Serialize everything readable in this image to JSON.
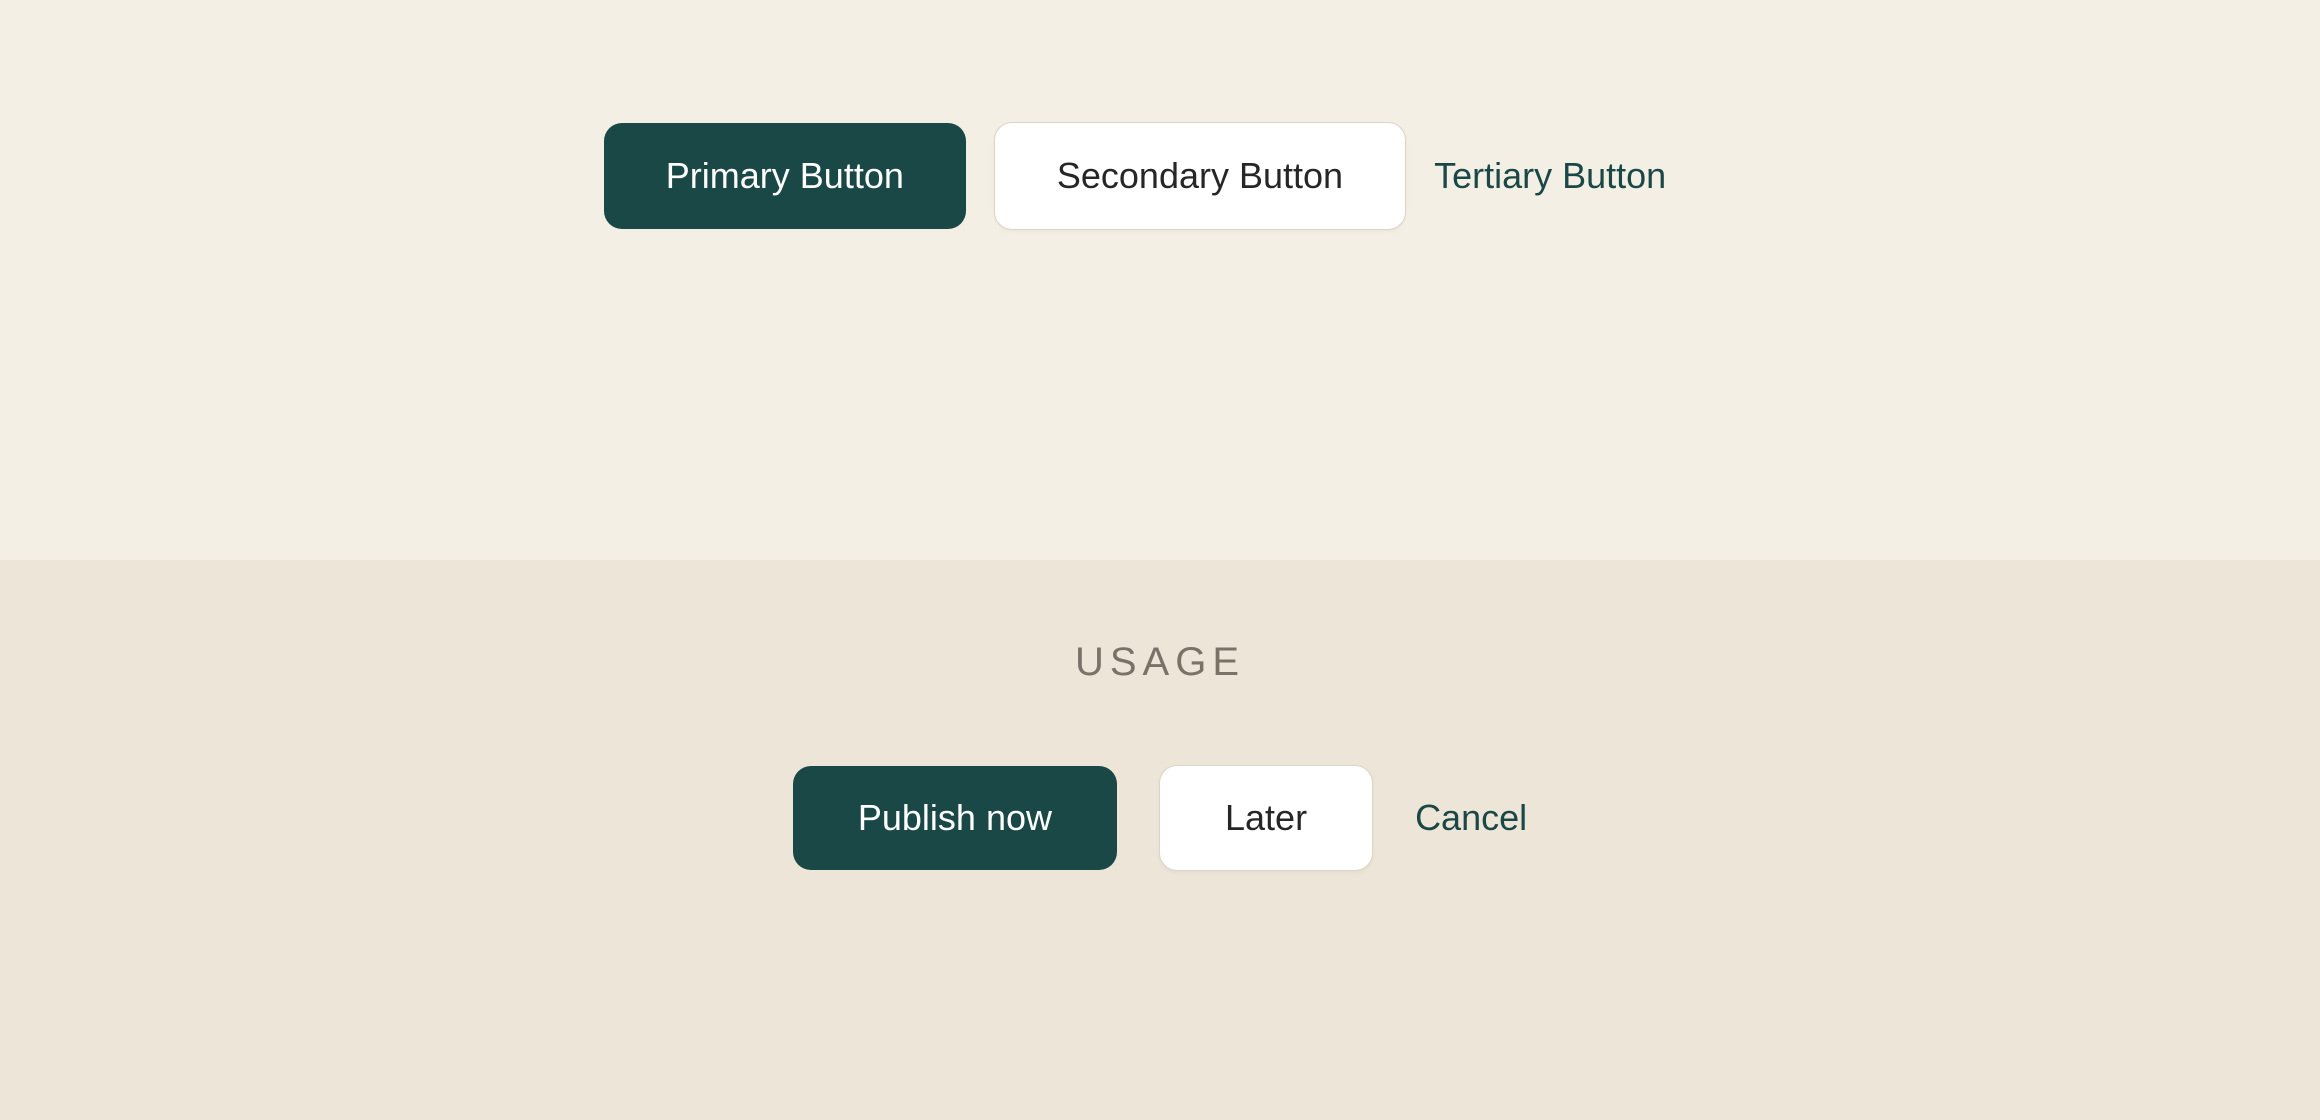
{
  "colors": {
    "primary": "#1a4847",
    "bg_top": "#f4efe4",
    "bg_bottom": "#ede5d7",
    "text_muted": "#7a7268"
  },
  "top": {
    "primary_label": "Primary Button",
    "secondary_label": "Secondary Button",
    "tertiary_label": "Tertiary Button"
  },
  "bottom": {
    "section_title": "USAGE",
    "primary_label": "Publish now",
    "secondary_label": "Later",
    "tertiary_label": "Cancel"
  }
}
